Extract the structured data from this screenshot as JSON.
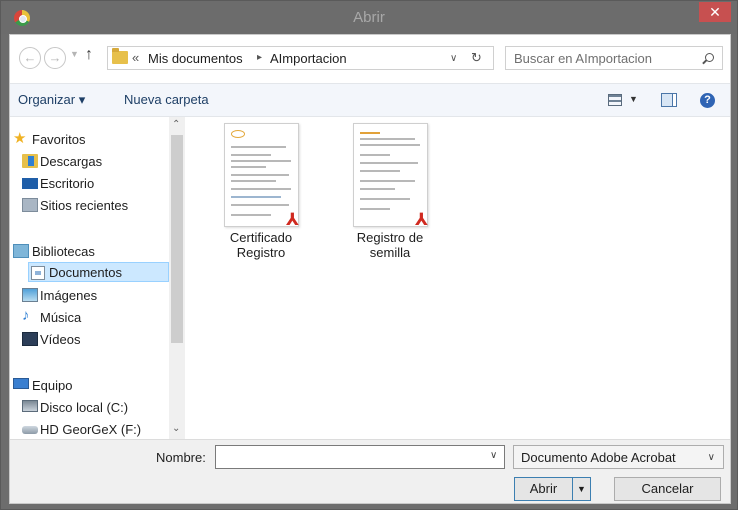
{
  "window": {
    "title": "Abrir",
    "close_label": "✕"
  },
  "address": {
    "chevron": "«",
    "crumbs": [
      "Mis documentos",
      "AImportacion"
    ],
    "separator": "▸"
  },
  "search": {
    "placeholder": "Buscar en AImportacion"
  },
  "toolbar": {
    "organize_label": "Organizar ▾",
    "new_folder_label": "Nueva carpeta"
  },
  "navigation": {
    "items": [
      {
        "label": "Favoritos",
        "icon": "star-icon"
      },
      {
        "label": "Descargas",
        "icon": "downloads-icon"
      },
      {
        "label": "Escritorio",
        "icon": "desktop-icon"
      },
      {
        "label": "Sitios recientes",
        "icon": "recent-places-icon"
      },
      {
        "label": "Bibliotecas",
        "icon": "libraries-icon"
      },
      {
        "label": "Documentos",
        "icon": "documents-icon",
        "selected": true
      },
      {
        "label": "Imágenes",
        "icon": "pictures-icon"
      },
      {
        "label": "Música",
        "icon": "music-icon"
      },
      {
        "label": "Vídeos",
        "icon": "videos-icon"
      },
      {
        "label": "Equipo",
        "icon": "computer-icon"
      },
      {
        "label": "Disco local (C:)",
        "icon": "disk-icon"
      },
      {
        "label": "HD GeorGeX (F:)",
        "icon": "hdd-icon"
      }
    ]
  },
  "files": [
    {
      "name_line1": "Certificado",
      "name_line2": "Registro",
      "icon": "pdf-icon"
    },
    {
      "name_line1": "Registro de",
      "name_line2": "semilla",
      "icon": "pdf-icon"
    }
  ],
  "bottom": {
    "name_label": "Nombre:",
    "name_value": "",
    "filetype_value": "Documento Adobe Acrobat",
    "open_label": "Abrir",
    "cancel_label": "Cancelar"
  },
  "colors": {
    "titlebar": "#6c6c6c",
    "close": "#c75050",
    "selection": "#cce8ff",
    "accent": "#1e3f66"
  }
}
